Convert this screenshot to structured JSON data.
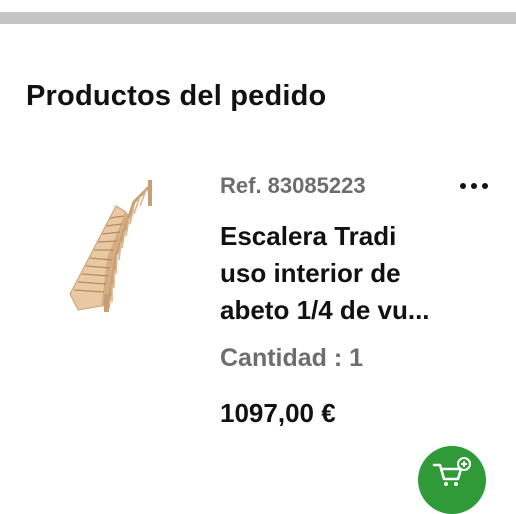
{
  "section": {
    "title": "Productos del pedido"
  },
  "product": {
    "reference": "Ref. 83085223",
    "name_line1": "Escalera Tradi",
    "name_line2": "uso interior de",
    "name_line3": "abeto 1/4 de vu...",
    "quantity": "Cantidad : 1",
    "price": "1097,00 €",
    "image_icon": "wooden-staircase-image",
    "more_icon": "more-options-icon"
  },
  "fab": {
    "icon": "add-to-cart-icon",
    "color": "#2f9a37"
  }
}
